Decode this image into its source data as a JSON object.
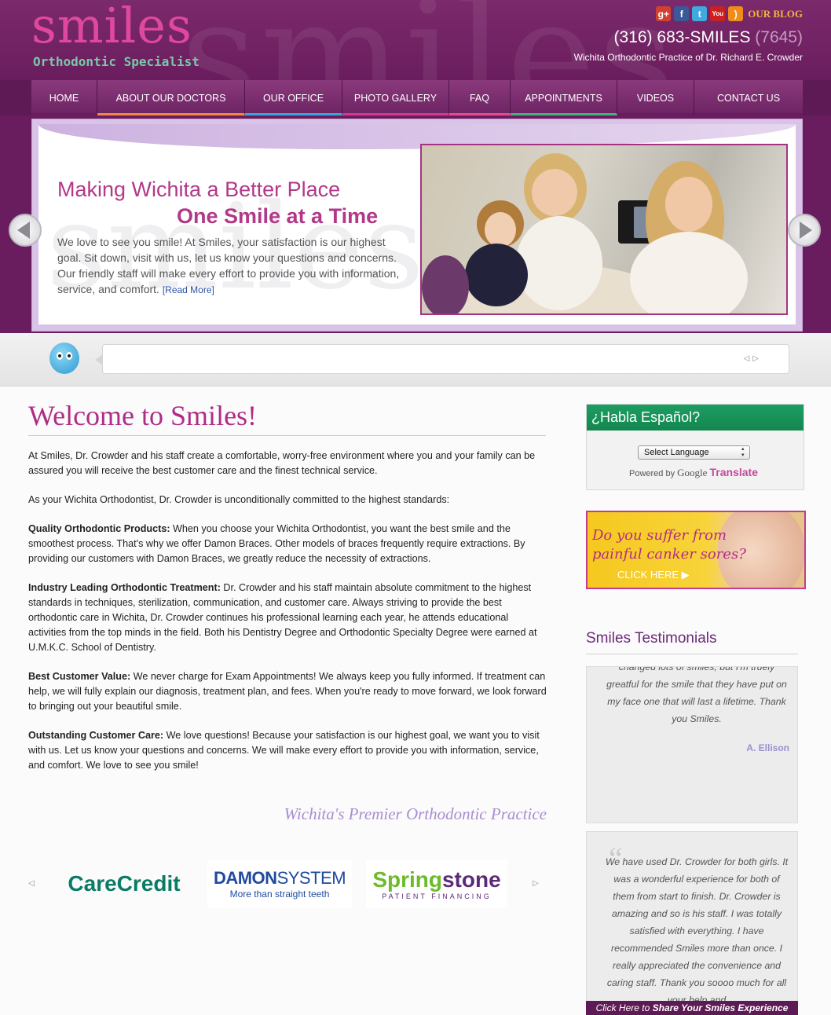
{
  "header": {
    "logo_main": "smiles",
    "logo_sub": "Orthodontic Specialist",
    "blog_label": "OUR BLOG",
    "phone_main": "(316) 683-SMILES",
    "phone_alt": "(7645)",
    "tagline": "Wichita Orthodontic Practice of Dr. Richard E. Crowder",
    "social_icons": [
      "google-plus-icon",
      "facebook-icon",
      "twitter-icon",
      "youtube-icon",
      "rss-icon"
    ]
  },
  "nav": {
    "items": [
      {
        "label": "HOME",
        "underline": "#6a1d5e"
      },
      {
        "label": "ABOUT OUR DOCTORS",
        "underline": "#f08a3c"
      },
      {
        "label": "OUR OFFICE",
        "underline": "#36a7d6"
      },
      {
        "label": "PHOTO GALLERY",
        "underline": "#d23a8e"
      },
      {
        "label": "FAQ",
        "underline": "#e64c8c"
      },
      {
        "label": "APPOINTMENTS",
        "underline": "#43b57c"
      },
      {
        "label": "VIDEOS",
        "underline": "#6a1d5e"
      },
      {
        "label": "CONTACT US",
        "underline": "#6a1d5e"
      }
    ]
  },
  "banner": {
    "heading1": "Making Wichita a Better Place",
    "heading2": "One Smile at a Time",
    "body": "We love to see you smile! At Smiles, your satisfaction is our highest goal. Sit down, visit with us, let us know your questions and concerns. Our friendly staff will make every effort to provide you with information, service, and comfort.",
    "read_more": "[Read More]"
  },
  "main": {
    "title": "Welcome to Smiles!",
    "intro": "At Smiles, Dr. Crowder and his staff create a comfortable, worry-free environment where you and your family can be assured you will receive the best customer care and the finest technical service.",
    "commitment": "As your Wichita Orthodontist, Dr. Crowder is unconditionally committed to the highest standards:",
    "sections": [
      {
        "heading": "Quality Orthodontic Products:",
        "text": " When you choose your Wichita Orthodontist, you want the best smile and the smoothest process. That's why we offer Damon Braces. Other models of braces frequently require extractions. By providing our customers with Damon Braces, we greatly reduce the necessity of extractions."
      },
      {
        "heading": "Industry Leading Orthodontic Treatment:",
        "text": " Dr. Crowder and his staff maintain absolute commitment to the highest standards in techniques, sterilization, communication, and customer care. Always striving to provide the best orthodontic care in Wichita, Dr. Crowder continues his professional learning each year, he attends educational activities from the top minds in the field. Both his Dentistry Degree and Orthodontic Specialty Degree were earned at U.M.K.C. School of Dentistry."
      },
      {
        "heading": "Best Customer Value:",
        "text": " We never charge for Exam Appointments! We always keep you fully informed. If treatment can help, we will fully explain our diagnosis, treatment plan, and fees. When you're ready to move forward, we look forward to bringing out your beautiful smile."
      },
      {
        "heading": "Outstanding Customer Care:",
        "text": " We love questions! Because your satisfaction is our highest goal, we want you to visit with us. Let us know your questions and concerns. We will make every effort to provide you with information, service, and comfort. We love to see you smile!"
      }
    ],
    "premier": "Wichita's Premier Orthodontic Practice"
  },
  "partners": {
    "carecredit": "CareCredit",
    "damon_1": "DAMON",
    "damon_1b": "SYSTEM",
    "damon_2": "More than straight teeth",
    "spring_1a": "Spring",
    "spring_1b": "stone",
    "spring_2": "PATIENT FINANCING"
  },
  "sidebar": {
    "espanol_title": "¿Habla Español?",
    "select_language": "Select Language",
    "powered_by": "Powered by",
    "google": "Google",
    "translate": "Translate",
    "canker_line1": "Do you suffer from",
    "canker_line2": "painful canker sores?",
    "canker_cta": "CLICK HERE",
    "testimonials_title": "Smiles Testimonials",
    "testimonial1": "changed lots of smiles, but I'm truely greatful for the smile that they have put on my face one that will last a lifetime. Thank you Smiles.",
    "testimonial1_author": "A. Ellison",
    "testimonial2": "We have used Dr. Crowder for both girls. It was a wonderful experience for both of them from start to finish. Dr. Crowder is amazing and so is his staff. I was totally satisfied with everything. I have recommended Smiles more than once. I really appreciated the convenience and caring staff. Thank you soooo much for all your help and",
    "share_prefix": "Click Here to ",
    "share_bold": "Share Your Smiles Experience"
  }
}
